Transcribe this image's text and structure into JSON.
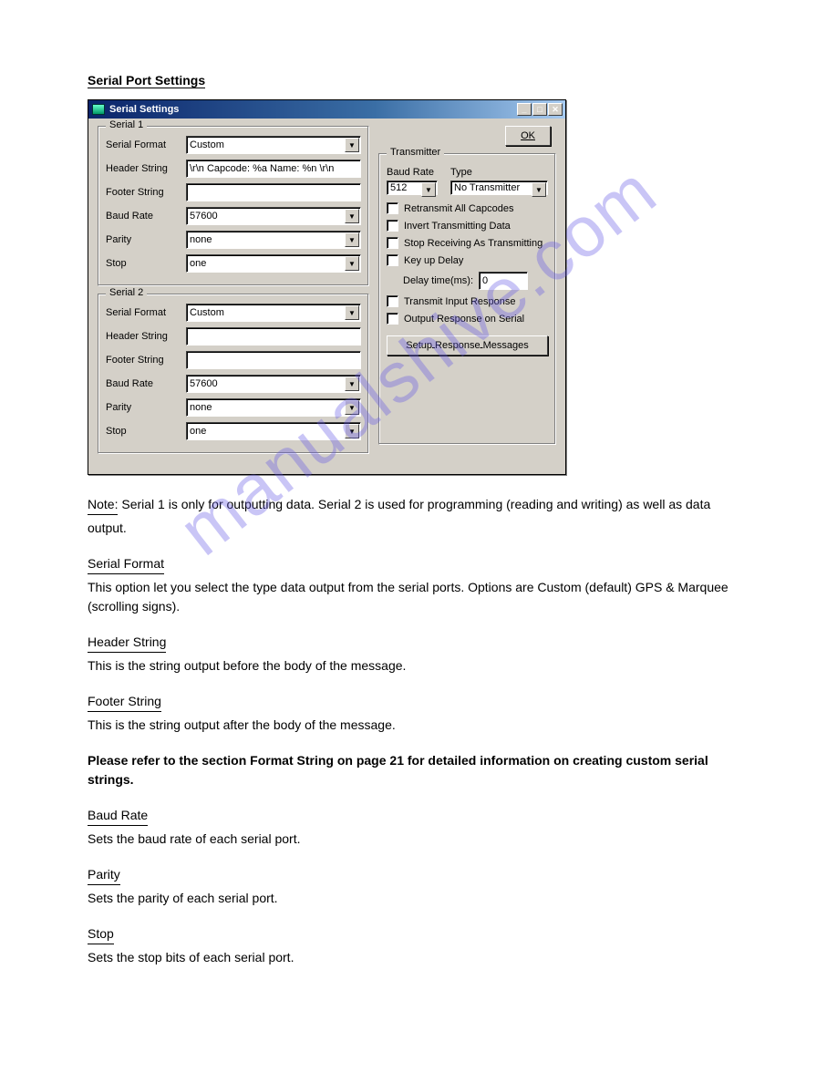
{
  "page_heading": "Serial Port Settings",
  "window": {
    "title": "Serial Settings",
    "ok_button": "OK",
    "serial1": {
      "legend": "Serial 1",
      "labels": {
        "format": "Serial Format",
        "header": "Header String",
        "footer": "Footer String",
        "baud": "Baud Rate",
        "parity": "Parity",
        "stop": "Stop"
      },
      "values": {
        "format": "Custom",
        "header": "\\r\\n Capcode: %a Name: %n \\r\\n",
        "footer": "",
        "baud": "57600",
        "parity": "none",
        "stop": "one"
      }
    },
    "serial2": {
      "legend": "Serial 2",
      "labels": {
        "format": "Serial Format",
        "header": "Header String",
        "footer": "Footer String",
        "baud": "Baud Rate",
        "parity": "Parity",
        "stop": "Stop"
      },
      "values": {
        "format": "Custom",
        "header": "",
        "footer": "",
        "baud": "57600",
        "parity": "none",
        "stop": "one"
      }
    },
    "transmitter": {
      "legend": "Transmitter",
      "baud_label": "Baud Rate",
      "type_label": "Type",
      "baud_value": "512",
      "type_value": "No Transmitter",
      "retransmit": "Retransmit All Capcodes",
      "invert": "Invert Transmitting Data",
      "stop_rx": "Stop Receiving As Transmitting",
      "keyup": "Key up Delay",
      "delay_label": "Delay time(ms):",
      "delay_value": "0",
      "tx_input": "Transmit Input Response",
      "out_serial": "Output Response on Serial",
      "setup_btn": "Setup Response Messages"
    }
  },
  "doc": {
    "note_head": "Note:",
    "note_body": " Serial 1 is only for outputting data. Serial 2 is used for programming (reading and writing) as well as data output.",
    "sf_head": "Serial Format",
    "sf_body": "This option let you select the type data output from the serial ports. Options are Custom (default) GPS & Marquee (scrolling signs).",
    "hs_head": "Header String",
    "hs_body": "This is the string output before the body of the message.",
    "fs_head": "Footer String",
    "fs_body": "This is the string output after the body of the message.",
    "notice": "Please refer to the section Format String on page 21 for detailed information on creating custom serial strings.",
    "br_head": "Baud Rate",
    "br_body": "Sets the baud rate of each serial port.",
    "pa_head": "Parity",
    "pa_body": "Sets the parity of each serial port.",
    "st_head": "Stop",
    "st_body": "Sets the stop bits of each serial port."
  },
  "watermark": "manualshive.com"
}
